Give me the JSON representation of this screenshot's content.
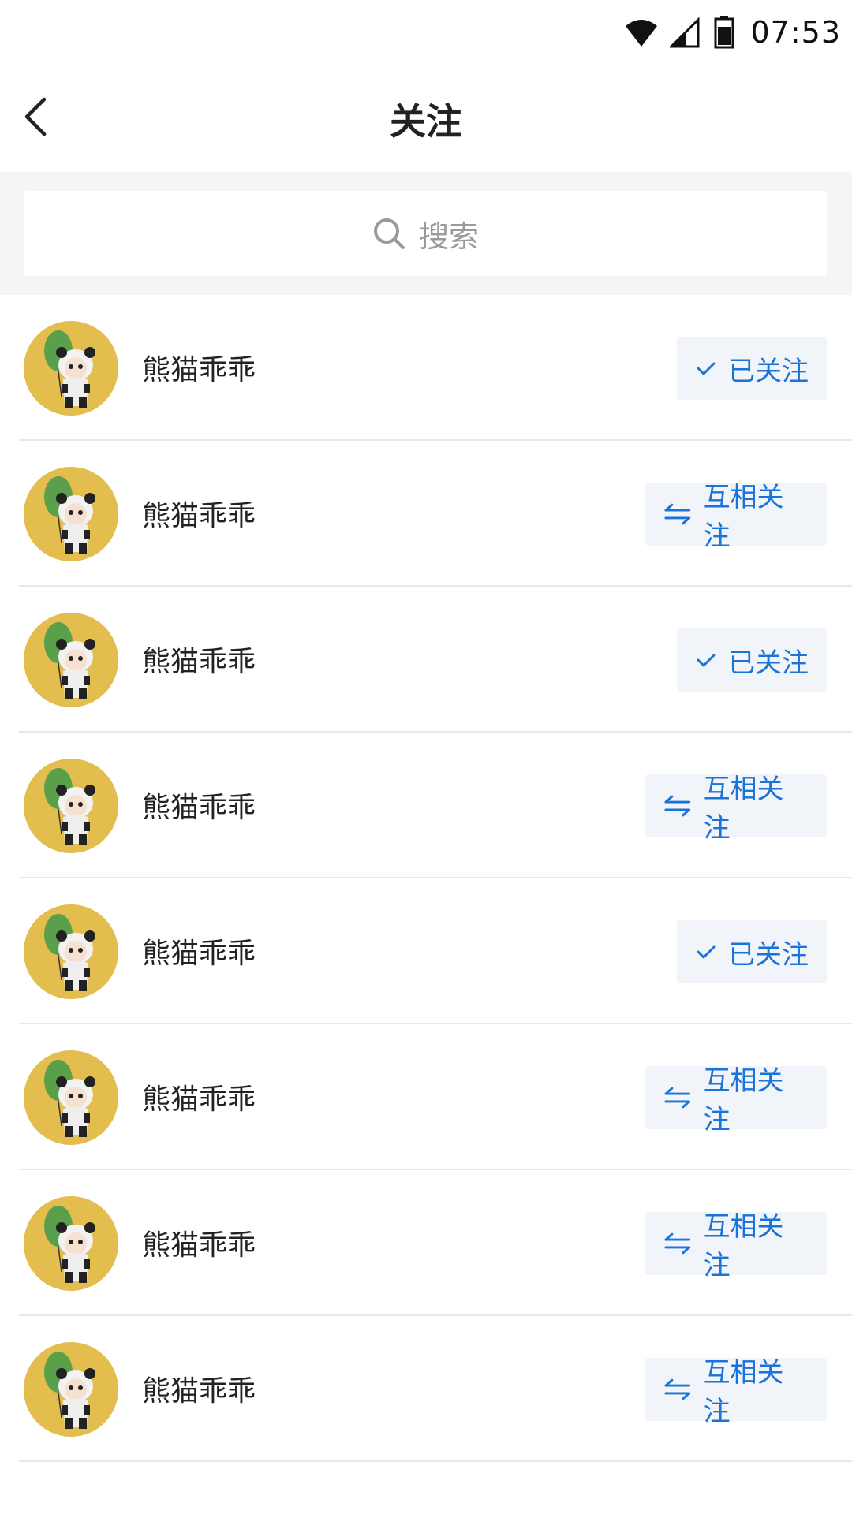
{
  "status_bar": {
    "time": "07:53",
    "icons": [
      "wifi-icon",
      "cell-signal-icon",
      "battery-icon"
    ]
  },
  "header": {
    "title": "关注",
    "back_icon": "back-chevron-icon"
  },
  "search": {
    "placeholder": "搜索",
    "icon": "search-icon"
  },
  "colors": {
    "accent": "#1a73d8",
    "button_bg": "#f1f4f8",
    "avatar_bg": "#e3bd4d",
    "search_bg": "#f4f5f7"
  },
  "users": [
    {
      "name": "熊猫乖乖",
      "status": "followed",
      "button_label": "已关注",
      "button_icon": "check-icon"
    },
    {
      "name": "熊猫乖乖",
      "status": "mutual",
      "button_label": "互相关注",
      "button_icon": "mutual-arrows-icon"
    },
    {
      "name": "熊猫乖乖",
      "status": "followed",
      "button_label": "已关注",
      "button_icon": "check-icon"
    },
    {
      "name": "熊猫乖乖",
      "status": "mutual",
      "button_label": "互相关注",
      "button_icon": "mutual-arrows-icon"
    },
    {
      "name": "熊猫乖乖",
      "status": "followed",
      "button_label": "已关注",
      "button_icon": "check-icon"
    },
    {
      "name": "熊猫乖乖",
      "status": "mutual",
      "button_label": "互相关注",
      "button_icon": "mutual-arrows-icon"
    },
    {
      "name": "熊猫乖乖",
      "status": "mutual",
      "button_label": "互相关注",
      "button_icon": "mutual-arrows-icon"
    },
    {
      "name": "熊猫乖乖",
      "status": "mutual",
      "button_label": "互相关注",
      "button_icon": "mutual-arrows-icon"
    }
  ]
}
